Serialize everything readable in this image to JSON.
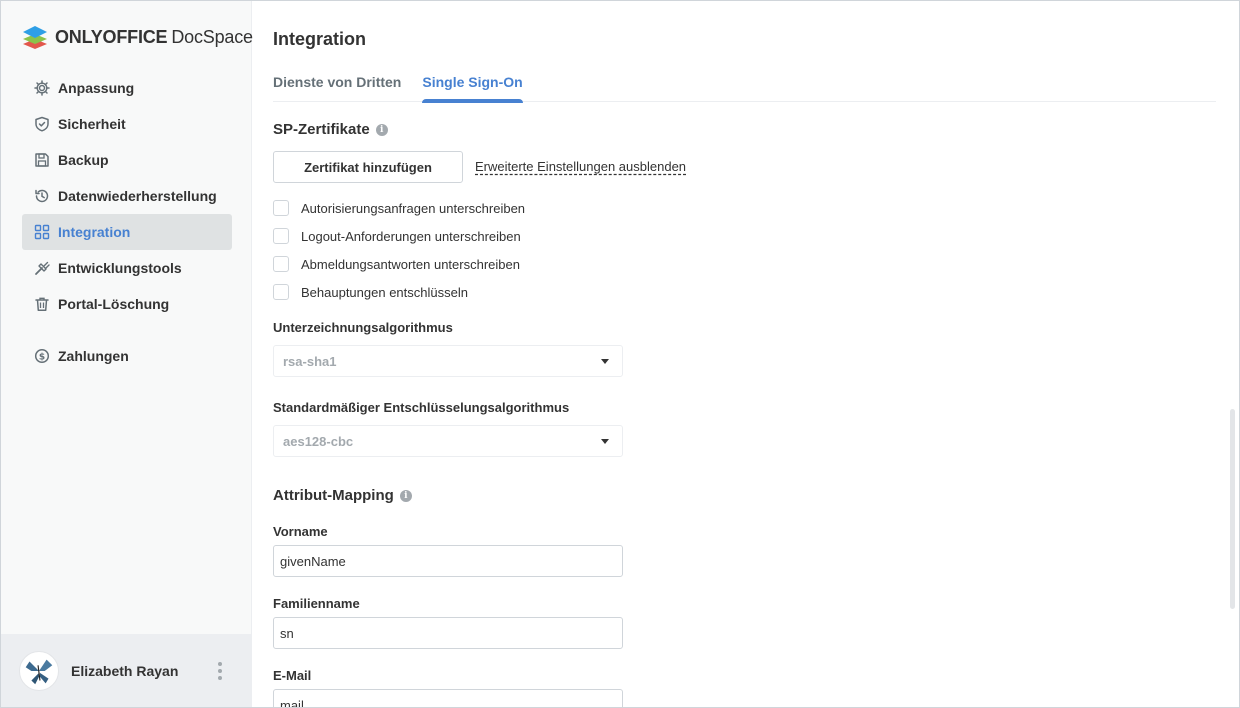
{
  "app": {
    "brand_bold": "ONLYOFFICE",
    "brand_thin": "DocSpace"
  },
  "sidebar": {
    "items": [
      {
        "label": "Anpassung",
        "icon": "gear-icon"
      },
      {
        "label": "Sicherheit",
        "icon": "shield-icon"
      },
      {
        "label": "Backup",
        "icon": "floppy-icon"
      },
      {
        "label": "Datenwiederherstellung",
        "icon": "restore-icon"
      },
      {
        "label": "Integration",
        "icon": "grid-icon",
        "active": true
      },
      {
        "label": "Entwicklungstools",
        "icon": "tools-icon"
      },
      {
        "label": "Portal-Löschung",
        "icon": "trash-icon"
      },
      {
        "label": "Zahlungen",
        "icon": "dollar-circle-icon"
      }
    ]
  },
  "profile": {
    "name": "Elizabeth Rayan"
  },
  "main": {
    "title": "Integration",
    "tabs": [
      {
        "label": "Dienste von Dritten"
      },
      {
        "label": "Single Sign-On",
        "active": true
      }
    ],
    "sp_certificates": {
      "title": "SP-Zertifikate",
      "add_button": "Zertifikat hinzufügen",
      "advanced_link": "Erweiterte Einstellungen ausblenden",
      "checkboxes": [
        {
          "label": "Autorisierungsanfragen unterschreiben",
          "checked": false
        },
        {
          "label": "Logout-Anforderungen unterschreiben",
          "checked": false
        },
        {
          "label": "Abmeldungsantworten unterschreiben",
          "checked": false
        },
        {
          "label": "Behauptungen entschlüsseln",
          "checked": false
        }
      ],
      "signing_algorithm": {
        "label": "Unterzeichnungsalgorithmus",
        "value": "rsa-sha1"
      },
      "decryption_algorithm": {
        "label": "Standardmäßiger Entschlüsselungsalgorithmus",
        "value": "aes128-cbc"
      }
    },
    "attribute_mapping": {
      "title": "Attribut-Mapping",
      "fields": [
        {
          "label": "Vorname",
          "value": "givenName"
        },
        {
          "label": "Familienname",
          "value": "sn"
        },
        {
          "label": "E-Mail",
          "value": "mail"
        }
      ]
    }
  },
  "colors": {
    "accent": "#4781d1",
    "sidebar_bg": "#f8f9f9",
    "active_item_bg": "#dfe2e3"
  }
}
